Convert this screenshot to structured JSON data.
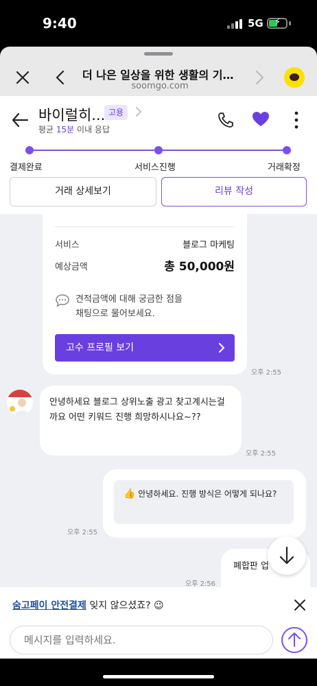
{
  "status_bar": {
    "time": "9:40",
    "network": "5G"
  },
  "browser": {
    "title": "더 나은 일상을 위한 생활의 기술...",
    "url": "soomgo.com"
  },
  "header": {
    "pro_name": "바이럴히...",
    "tag": "고용",
    "response_prefix": "평균 ",
    "response_highlight": "15분",
    "response_suffix": " 이내 응답"
  },
  "progress": {
    "steps": [
      "결제완료",
      "서비스진행",
      "거래확정"
    ]
  },
  "actions": {
    "detail_label": "거래 상세보기",
    "review_label": "리뷰 작성"
  },
  "quote_card": {
    "service_label": "서비스",
    "service_value": "블로그 마케팅",
    "price_label": "예상금액",
    "price_value": "총 50,000원",
    "notice_line1": "견적금액에 대해 궁금한 점을",
    "notice_line2": "채팅으로 물어보세요.",
    "profile_button": "고수 프로필 보기",
    "timestamp": "오후 2:55"
  },
  "messages": [
    {
      "from": "pro",
      "text": "안녕하세요 블로그 상위노출 광고 찾고계시는걸까요 어떤 키워드 진행 희망하시나요~??",
      "time": "오후 2:55"
    },
    {
      "from": "me",
      "emoji": "👍",
      "text": "안녕하세요. 진행 방식은 어떻게 되나요?",
      "time": "오후 2:55"
    },
    {
      "from": "me",
      "text": "폐합판 업",
      "time": "오후 2:56"
    }
  ],
  "footer": {
    "pay_link": "숨고페이 안전결제",
    "pay_text": " 잊지 않으셨죠? ",
    "pay_emoji": "😉",
    "input_placeholder": "메시지를 입력하세요."
  },
  "colors": {
    "accent": "#7b4fe8",
    "tag_bg": "#ece5fd",
    "chat_bg": "#eef0f3",
    "link": "#1f4fa3"
  }
}
